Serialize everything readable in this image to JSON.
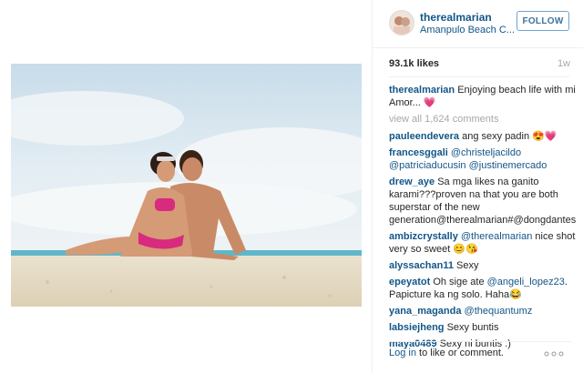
{
  "header": {
    "username": "therealmarian",
    "location": "Amanpulo Beach C...",
    "follow_label": "FOLLOW"
  },
  "stats": {
    "likes": "93.1k likes",
    "time": "1w"
  },
  "caption": {
    "user": "therealmarian",
    "text": "Enjoying beach life with mi Amor...",
    "emoji": "💗"
  },
  "view_all": "view all 1,624 comments",
  "comments": [
    {
      "user": "pauleendevera",
      "text": "ang sexy padin 😍💗"
    },
    {
      "user": "francesggali",
      "mentions": "@christeljacildo @patriciaducusin @justinemercado"
    },
    {
      "user": "drew_aye",
      "text": "Sa mga likes na ganito karami???proven na that you are both superstar of the new generation@therealmarian#@dongdantes"
    },
    {
      "user": "ambizcrystally",
      "mention": "@therealmarian",
      "text": "nice shot very so sweet 😊😘"
    },
    {
      "user": "alyssachan11",
      "text": "Sexy"
    },
    {
      "user": "epeyatot",
      "text_a": "Oh sige ate",
      "mention": "@angeli_lopez23",
      "text_b": ". Papicture ka ng solo. Haha😂"
    },
    {
      "user": "yana_maganda",
      "mention": "@thequantumz"
    },
    {
      "user": "labsiejheng",
      "text": "Sexy buntis"
    },
    {
      "user": "maya0489",
      "text": "Sexy ni buntis :)"
    }
  ],
  "footer": {
    "login": "Log in",
    "rest": " to like or comment.",
    "more_icon": "more-dots-icon"
  }
}
